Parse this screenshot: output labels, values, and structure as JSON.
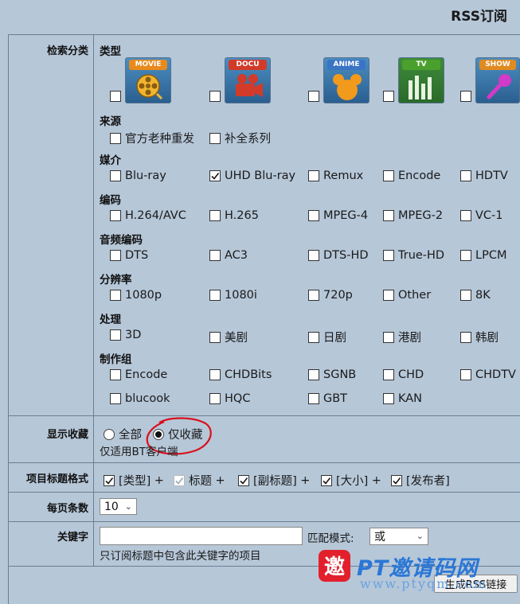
{
  "page_title": "RSS订阅",
  "rows": {
    "search_category": "检索分类",
    "show_favorites": "显示收藏",
    "item_title_format": "项目标题格式",
    "per_page": "每页条数",
    "keyword": "关键字"
  },
  "category": {
    "title": "类型",
    "icons": [
      {
        "badge": "MOVIE",
        "icon": "film-reel-icon",
        "badge_color": "#e88a1c"
      },
      {
        "badge": "DOCU",
        "icon": "video-camera-icon",
        "badge_color": "#d23a2a"
      },
      {
        "badge": "ANIME",
        "icon": "cartoon-mouse-icon",
        "badge_color": "#3a74c4"
      },
      {
        "badge": "TV",
        "icon": "tv-bars-icon",
        "badge_color": "#4aa02c"
      },
      {
        "badge": "SHOW",
        "icon": "microphone-icon",
        "badge_color": "#e08a20"
      }
    ]
  },
  "source": {
    "title": "来源",
    "options": [
      "官方老种重发",
      "补全系列"
    ]
  },
  "medium": {
    "title": "媒介",
    "options": [
      "Blu-ray",
      "UHD Blu-ray",
      "Remux",
      "Encode",
      "HDTV"
    ],
    "checked": [
      "UHD Blu-ray"
    ]
  },
  "codec": {
    "title": "编码",
    "options": [
      "H.264/AVC",
      "H.265",
      "MPEG-4",
      "MPEG-2",
      "VC-1"
    ]
  },
  "audio": {
    "title": "音频编码",
    "options": [
      "DTS",
      "AC3",
      "DTS-HD",
      "True-HD",
      "LPCM"
    ]
  },
  "resolution": {
    "title": "分辨率",
    "options": [
      "1080p",
      "1080i",
      "720p",
      "Other",
      "8K"
    ]
  },
  "processing": {
    "title": "处理",
    "options": [
      "3D",
      "美剧",
      "日剧",
      "港剧",
      "韩剧"
    ]
  },
  "team": {
    "title": "制作组",
    "options": [
      "Encode",
      "CHDBits",
      "SGNB",
      "CHD",
      "CHDTV",
      "blucook",
      "HQC",
      "GBT",
      "KAN"
    ]
  },
  "favorites": {
    "all": "全部",
    "only": "仅收藏",
    "selected": "仅收藏",
    "note": "仅适用BT客户端"
  },
  "title_format": {
    "items": [
      {
        "label": "[类型]",
        "sep": "+",
        "checked": true
      },
      {
        "label": "标题",
        "sep": "+",
        "checked": true,
        "disabled": true
      },
      {
        "label": "[副标题]",
        "sep": "+",
        "checked": true
      },
      {
        "label": "[大小]",
        "sep": "+",
        "checked": true
      },
      {
        "label": "[发布者]",
        "sep": "",
        "checked": true
      }
    ]
  },
  "per_page_value": "10",
  "keyword_field": {
    "value": "",
    "match_label": "匹配模式:",
    "match_value": "或",
    "hint": "只订阅标题中包含此关键字的项目"
  },
  "generate_button": "生成RSS链接",
  "watermark": {
    "text": "PT邀请码网",
    "url": "www.ptyqm.com",
    "logo_char": "邀"
  },
  "colors": {
    "check": "#1a1a1a",
    "annotation_red": "#d8101c",
    "watermark_blue": "#2b77d6"
  }
}
